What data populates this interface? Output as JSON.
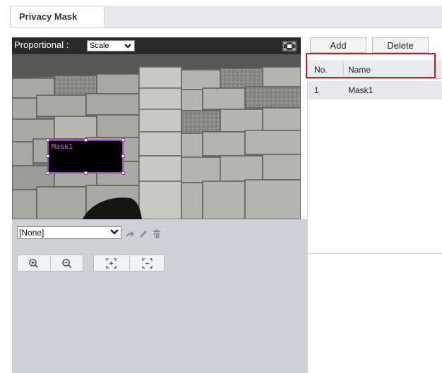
{
  "tab": {
    "label": "Privacy Mask"
  },
  "video": {
    "proportional_label": "Proportional :",
    "scale_value": "Scale",
    "mask_label": "Mask1"
  },
  "controls": {
    "shape_select_value": "[None]"
  },
  "toolbar": {
    "add_label": "Add",
    "delete_label": "Delete"
  },
  "table": {
    "columns": [
      "No.",
      "Name"
    ],
    "rows": [
      {
        "no": "1",
        "name": "Mask1"
      }
    ]
  },
  "colors": {
    "highlight": "#e0101a",
    "mask_border": "#9b3fb8"
  }
}
